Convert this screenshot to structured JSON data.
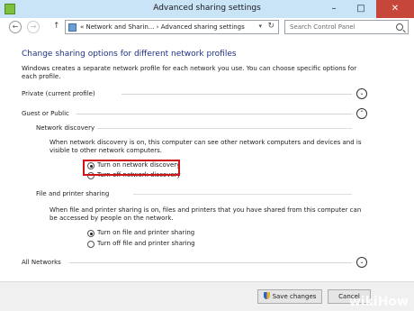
{
  "window": {
    "title": "Advanced sharing settings",
    "minimize_glyph": "–",
    "maximize_glyph": "□",
    "close_glyph": "✕"
  },
  "nav": {
    "back_glyph": "←",
    "forward_glyph": "→",
    "up_glyph": "↑",
    "address": "« Network and Sharin...  ›  Advanced sharing settings",
    "address_dropdown_glyph": "▾",
    "refresh_glyph": "↻",
    "search_placeholder": "Search Control Panel"
  },
  "main": {
    "heading": "Change sharing options for different network profiles",
    "intro": "Windows creates a separate network profile for each network you use. You can choose specific options for each profile.",
    "profiles": [
      {
        "label": "Private (current profile)",
        "state": "collapsed",
        "chevron": "⌄"
      },
      {
        "label": "Guest or Public",
        "state": "expanded",
        "chevron": "⌃"
      },
      {
        "label": "All Networks",
        "state": "collapsed",
        "chevron": "⌄"
      }
    ],
    "network_discovery": {
      "heading": "Network discovery",
      "description": "When network discovery is on, this computer can see other network computers and devices and is visible to other network computers.",
      "options": [
        {
          "label": "Turn on network discovery",
          "checked": true
        },
        {
          "label": "Turn off network discovery",
          "checked": false
        }
      ]
    },
    "file_sharing": {
      "heading": "File and printer sharing",
      "description": "When file and printer sharing is on, files and printers that you have shared from this computer can be accessed by people on the network.",
      "options": [
        {
          "label": "Turn on file and printer sharing",
          "checked": true
        },
        {
          "label": "Turn off file and printer sharing",
          "checked": false
        }
      ]
    }
  },
  "footer": {
    "save_label": "Save changes",
    "cancel_label": "Cancel"
  },
  "watermark": {
    "wiki": "wiki",
    "how": "How"
  },
  "colors": {
    "titlebar": "#c9e3f7",
    "heading": "#1e3287",
    "highlight": "#d1141a",
    "close_button": "#c7463a"
  }
}
